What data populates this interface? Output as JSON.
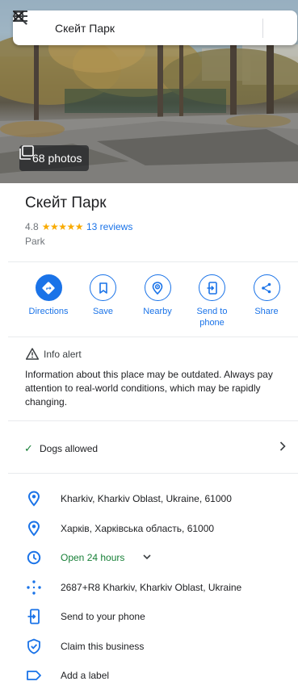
{
  "search": {
    "query": "Скейт Парк"
  },
  "photos": {
    "label": "68 photos"
  },
  "place": {
    "name": "Скейт Парк",
    "rating": "4.8",
    "stars": "★★★★★",
    "reviews": "13 reviews",
    "category": "Park"
  },
  "actions": [
    {
      "label": "Directions",
      "icon": "directions-icon"
    },
    {
      "label": "Save",
      "icon": "bookmark-icon"
    },
    {
      "label": "Nearby",
      "icon": "nearby-icon"
    },
    {
      "label": "Send to phone",
      "icon": "send-to-phone-icon"
    },
    {
      "label": "Share",
      "icon": "share-icon"
    }
  ],
  "alert": {
    "title": "Info alert",
    "text": "Information about this place may be outdated. Always pay attention to real-world conditions, which may be rapidly changing."
  },
  "amenity": {
    "check": "✓",
    "label": "Dogs allowed"
  },
  "info": {
    "address_en": "Kharkiv, Kharkiv Oblast, Ukraine, 61000",
    "address_uk": "Харків, Харківська область, 61000",
    "hours": "Open 24 hours",
    "plus_code": "2687+R8 Kharkiv, Kharkiv Oblast, Ukraine",
    "send_to_phone": "Send to your phone",
    "claim": "Claim this business",
    "add_label": "Add a label"
  },
  "colors": {
    "accent": "#1a73e8",
    "open": "#188038",
    "star": "#f9ab00"
  }
}
